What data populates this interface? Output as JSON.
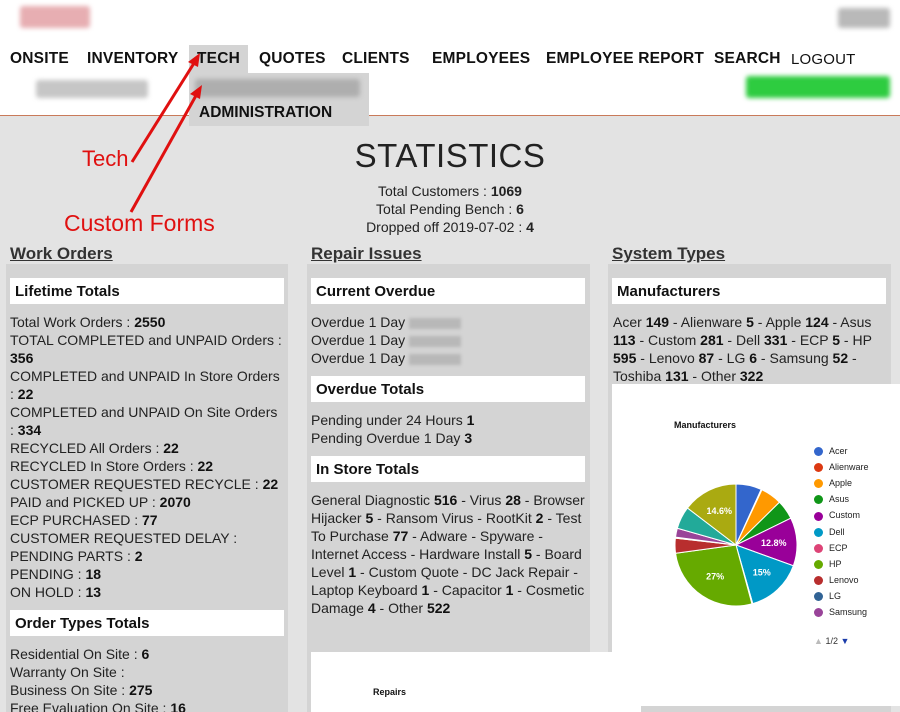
{
  "nav": {
    "items": [
      "ONSITE",
      "INVENTORY",
      "TECH",
      "QUOTES",
      "CLIENTS",
      "EMPLOYEES",
      "EMPLOYEE REPORT",
      "SEARCH"
    ],
    "logout": "LOGOUT",
    "active": "TECH",
    "dropdown_item": "ADMINISTRATION"
  },
  "annotations": {
    "tech": "Tech",
    "custom_forms": "Custom Forms",
    "color": "#e01010"
  },
  "page": {
    "title": "STATISTICS",
    "total_customers_label": "Total Customers :",
    "total_customers": "1069",
    "pending_bench_label": "Total Pending Bench :",
    "pending_bench": "6",
    "dropped_label": "Dropped off 2019-07-02 :",
    "dropped": "4"
  },
  "work_orders": {
    "heading": "Work Orders",
    "lifetime": {
      "title": "Lifetime Totals",
      "rows": [
        {
          "label": "Total Work Orders : ",
          "value": "2550"
        },
        {
          "label": "TOTAL COMPLETED and UNPAID Orders : ",
          "value": "356"
        },
        {
          "label": "COMPLETED and UNPAID In Store Orders : ",
          "value": "22"
        },
        {
          "label": "COMPLETED and UNPAID On Site Orders : ",
          "value": "334"
        },
        {
          "label": "RECYCLED All Orders : ",
          "value": "22"
        },
        {
          "label": "RECYCLED In Store Orders : ",
          "value": "22"
        },
        {
          "label": "CUSTOMER REQUESTED RECYCLE : ",
          "value": "22"
        },
        {
          "label": "PAID and PICKED UP : ",
          "value": "2070"
        },
        {
          "label": "ECP PURCHASED : ",
          "value": "77"
        },
        {
          "label": "CUSTOMER REQUESTED DELAY : ",
          "value": ""
        },
        {
          "label": "PENDING PARTS : ",
          "value": "2"
        },
        {
          "label": "PENDING : ",
          "value": "18"
        },
        {
          "label": "ON HOLD : ",
          "value": "13"
        }
      ]
    },
    "order_types": {
      "title": "Order Types Totals",
      "rows": [
        {
          "label": "Residential On Site : ",
          "value": "6"
        },
        {
          "label": "Warranty On Site : ",
          "value": ""
        },
        {
          "label": "Business On Site : ",
          "value": "275"
        },
        {
          "label": "Free Evaluation On Site : ",
          "value": "16"
        }
      ]
    }
  },
  "repair_issues": {
    "heading": "Repair Issues",
    "current_overdue": {
      "title": "Current Overdue",
      "rows": [
        "Overdue 1 Day",
        "Overdue 1 Day",
        "Overdue 1 Day"
      ]
    },
    "overdue_totals": {
      "title": "Overdue Totals",
      "rows": [
        {
          "label": "Pending under 24 Hours ",
          "value": "1"
        },
        {
          "label": "Pending Overdue 1 Day ",
          "value": "3"
        }
      ]
    },
    "in_store": {
      "title": "In Store Totals",
      "items": [
        {
          "label": "General Diagnostic",
          "value": "516"
        },
        {
          "label": "Virus",
          "value": "28"
        },
        {
          "label": "Browser Hijacker",
          "value": "5"
        },
        {
          "label": "Ransom Virus",
          "value": ""
        },
        {
          "label": "RootKit",
          "value": "2"
        },
        {
          "label": "Test To Purchase",
          "value": "77"
        },
        {
          "label": "Adware",
          "value": ""
        },
        {
          "label": "Spyware",
          "value": ""
        },
        {
          "label": "Internet Access",
          "value": ""
        },
        {
          "label": "Hardware Install",
          "value": "5"
        },
        {
          "label": "Board Level",
          "value": "1"
        },
        {
          "label": "Custom Quote",
          "value": ""
        },
        {
          "label": "DC Jack Repair",
          "value": ""
        },
        {
          "label": "Laptop Keyboard",
          "value": "1"
        },
        {
          "label": "Capacitor",
          "value": "1"
        },
        {
          "label": "Cosmetic Damage",
          "value": "4"
        },
        {
          "label": "Other",
          "value": "522"
        }
      ]
    },
    "repairs_card_title": "Repairs"
  },
  "system_types": {
    "heading": "System Types",
    "manufacturers": {
      "title": "Manufacturers",
      "items": [
        {
          "label": "Acer",
          "value": "149"
        },
        {
          "label": "Alienware",
          "value": "5"
        },
        {
          "label": "Apple",
          "value": "124"
        },
        {
          "label": "Asus",
          "value": "113"
        },
        {
          "label": "Custom",
          "value": "281"
        },
        {
          "label": "Dell",
          "value": "331"
        },
        {
          "label": "ECP",
          "value": "5"
        },
        {
          "label": "HP",
          "value": "595"
        },
        {
          "label": "Lenovo",
          "value": "87"
        },
        {
          "label": "LG",
          "value": "6"
        },
        {
          "label": "Samsung",
          "value": "52"
        },
        {
          "label": "Toshiba",
          "value": "131"
        },
        {
          "label": "Other",
          "value": "322"
        }
      ]
    }
  },
  "chart_data": {
    "type": "pie",
    "title": "Manufacturers",
    "categories": [
      "Acer",
      "Alienware",
      "Apple",
      "Asus",
      "Custom",
      "Dell",
      "ECP",
      "HP",
      "Lenovo",
      "LG",
      "Samsung",
      "Toshiba",
      "Other"
    ],
    "values": [
      149,
      5,
      124,
      113,
      281,
      331,
      5,
      595,
      87,
      6,
      52,
      131,
      322
    ],
    "colors": [
      "#3366cc",
      "#dc3912",
      "#ff9900",
      "#109618",
      "#990099",
      "#0099c6",
      "#dd4477",
      "#66aa00",
      "#b82e2e",
      "#316395",
      "#994499",
      "#22aa99",
      "#aaaa11"
    ],
    "slice_labels": [
      {
        "category": "Custom",
        "text": "12.8%"
      },
      {
        "category": "Dell",
        "text": "15%"
      },
      {
        "category": "HP",
        "text": "27%"
      },
      {
        "category": "Other",
        "text": "14.6%"
      }
    ],
    "legend_visible": [
      "Acer",
      "Alienware",
      "Apple",
      "Asus",
      "Custom",
      "Dell",
      "ECP",
      "HP",
      "Lenovo",
      "LG",
      "Samsung"
    ],
    "legend_position": "right",
    "pager_text": "1/2"
  }
}
